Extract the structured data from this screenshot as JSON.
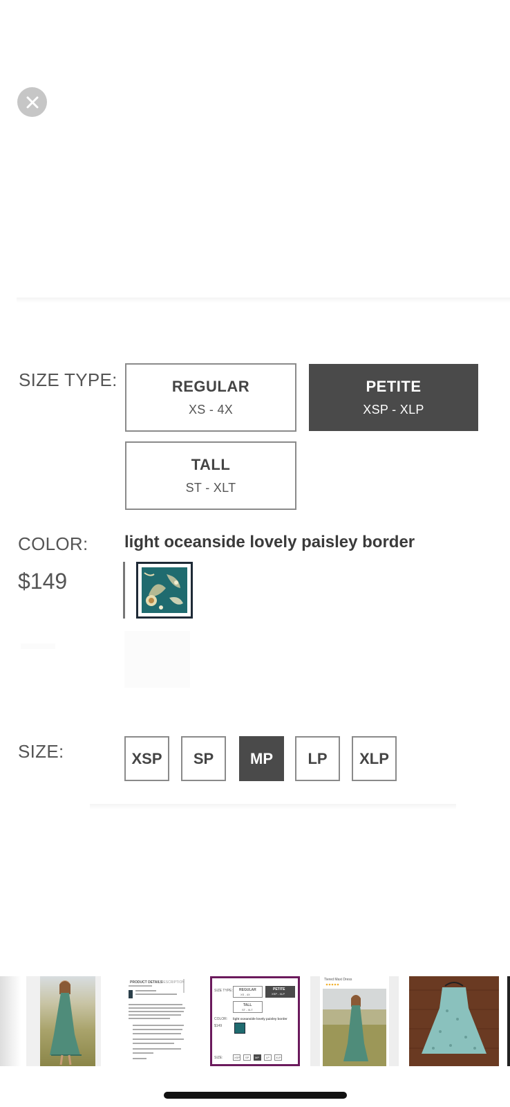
{
  "close": {
    "icon": "close-icon"
  },
  "size_type": {
    "label": "SIZE TYPE:",
    "options": [
      {
        "name": "REGULAR",
        "range": "XS - 4X",
        "selected": false
      },
      {
        "name": "PETITE",
        "range": "XSP - XLP",
        "selected": true
      },
      {
        "name": "TALL",
        "range": "ST - XLT",
        "selected": false
      }
    ]
  },
  "color": {
    "label": "COLOR:",
    "name": "light oceanside lovely paisley border",
    "price": "$149",
    "swatch_color": "#1f6b6f"
  },
  "size": {
    "label": "SIZE:",
    "options": [
      {
        "name": "XSP",
        "selected": false
      },
      {
        "name": "SP",
        "selected": false
      },
      {
        "name": "MP",
        "selected": true
      },
      {
        "name": "LP",
        "selected": false
      },
      {
        "name": "XLP",
        "selected": false
      }
    ]
  },
  "thumbnails": {
    "selected_index": 2,
    "selected_border_color": "#6b1a5c",
    "details_thumb": {
      "heading": "PRODUCT DETAILS",
      "tab": "FIT DESCRIPTION"
    },
    "size_thumb": {
      "size_type_label": "SIZE TYPE:",
      "regular": "REGULAR",
      "regular_range": "XS - 4X",
      "petite": "PETITE",
      "petite_range": "XSP - XLP",
      "tall": "TALL",
      "tall_range": "ST - XLT",
      "color_label": "COLOR:",
      "price": "$149",
      "color_name": "light oceanside lovely paisley border",
      "size_label": "SIZE:",
      "sizes": [
        "XSP",
        "SP",
        "MP",
        "LP",
        "XLP"
      ]
    },
    "dress_thumb": {
      "title": "Tiered Maxi Dress"
    }
  }
}
